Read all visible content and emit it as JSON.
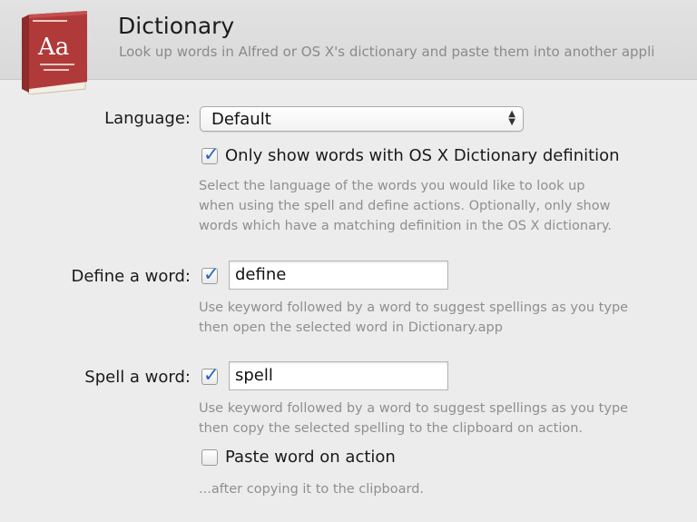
{
  "header": {
    "title": "Dictionary",
    "subtitle": "Look up words in Alfred or OS X's dictionary and paste them into another appli",
    "icon": "dictionary-book-icon",
    "icon_text": "Aa",
    "icon_color": "#b03a3a"
  },
  "language": {
    "label": "Language:",
    "selected": "Default",
    "only_show_checked": true,
    "only_show_label": "Only show words with OS X Dictionary definition",
    "help": [
      "Select the language of the words you would like to look up",
      "when using the spell and define actions. Optionally, only show",
      "words which have a matching definition in the OS X dictionary."
    ]
  },
  "define": {
    "label": "Define a word:",
    "enabled": true,
    "keyword": "define",
    "help": [
      "Use keyword followed by a word to suggest spellings as you type",
      "then open the selected word in Dictionary.app"
    ]
  },
  "spell": {
    "label": "Spell a word:",
    "enabled": true,
    "keyword": "spell",
    "help": [
      "Use keyword followed by a word to suggest spellings as you type",
      "then copy the selected spelling to the clipboard on action."
    ],
    "paste_checked": false,
    "paste_label": "Paste word on action",
    "paste_help": "...after copying it to the clipboard."
  },
  "colors": {
    "accent": "#1f66c8",
    "help_text": "#8f8f8f",
    "header_bg": "#dedede"
  }
}
